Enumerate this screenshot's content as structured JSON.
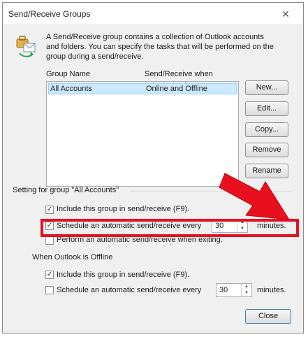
{
  "window": {
    "title": "Send/Receive Groups",
    "close_glyph": "✕"
  },
  "description": "A Send/Receive group contains a collection of Outlook accounts and folders. You can specify the tasks that will be performed on the group during a send/receive.",
  "list": {
    "col_group": "Group Name",
    "col_when": "Send/Receive when",
    "rows": [
      {
        "name": "All Accounts",
        "when": "Online and Offline"
      }
    ]
  },
  "buttons": {
    "new": "New...",
    "edit": "Edit...",
    "copy": "Copy...",
    "remove": "Remove",
    "rename": "Rename",
    "close": "Close"
  },
  "settings_group": {
    "label": "Setting for group \"All Accounts\"",
    "include": "Include this group in send/receive (F9).",
    "schedule": "Schedule an automatic send/receive every",
    "schedule_value": "30",
    "minutes": "minutes.",
    "exiting": "Perform an automatic send/receive when exiting."
  },
  "offline": {
    "label": "When Outlook is Offline",
    "include": "Include this group in send/receive (F9).",
    "schedule": "Schedule an automatic send/receive every",
    "schedule_value": "30",
    "minutes": "minutes."
  },
  "check_glyph": "✓",
  "colors": {
    "highlight": "#e8101f",
    "selection": "#cce8ff"
  },
  "icons": {
    "app": "send-receive-icon"
  }
}
